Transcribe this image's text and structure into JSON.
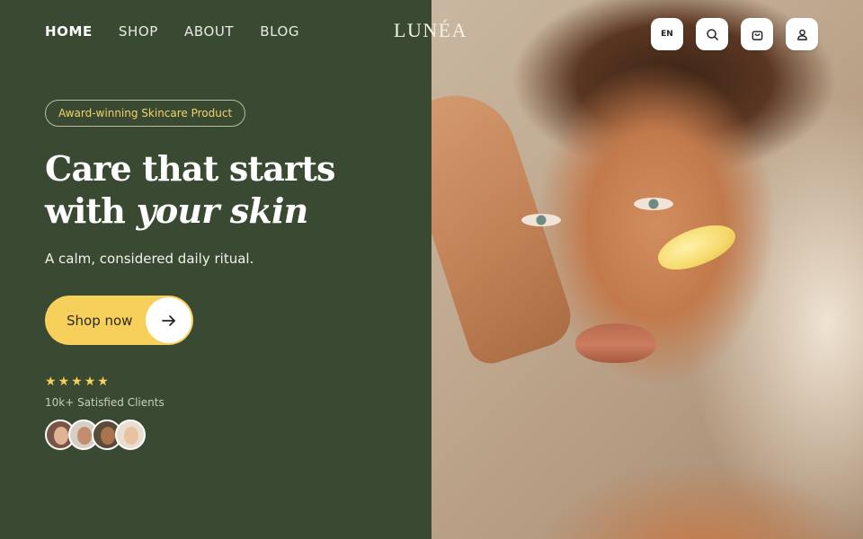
{
  "nav": {
    "items": [
      {
        "label": "HOME",
        "active": true
      },
      {
        "label": "SHOP",
        "active": false
      },
      {
        "label": "ABOUT",
        "active": false
      },
      {
        "label": "BLOG",
        "active": false
      }
    ]
  },
  "brand": {
    "logo": "LUNÉA"
  },
  "header_actions": {
    "language": "EN",
    "search_icon": "search-icon",
    "cart_icon": "cart-icon",
    "account_icon": "user-icon"
  },
  "hero": {
    "badge": "Award-winning Skincare Product",
    "headline_line1": "Care that starts",
    "headline_line2_prefix": "with ",
    "headline_line2_emphasis": "your skin",
    "subtitle": "A calm, considered daily ritual.",
    "cta_label": "Shop now",
    "cta_icon": "arrow-right-icon",
    "rating": 5,
    "clients_label": "10k+ Satisfied Clients"
  },
  "colors": {
    "panel": "#3a4a32",
    "accent": "#f7cf5b",
    "text": "#ffffff"
  }
}
